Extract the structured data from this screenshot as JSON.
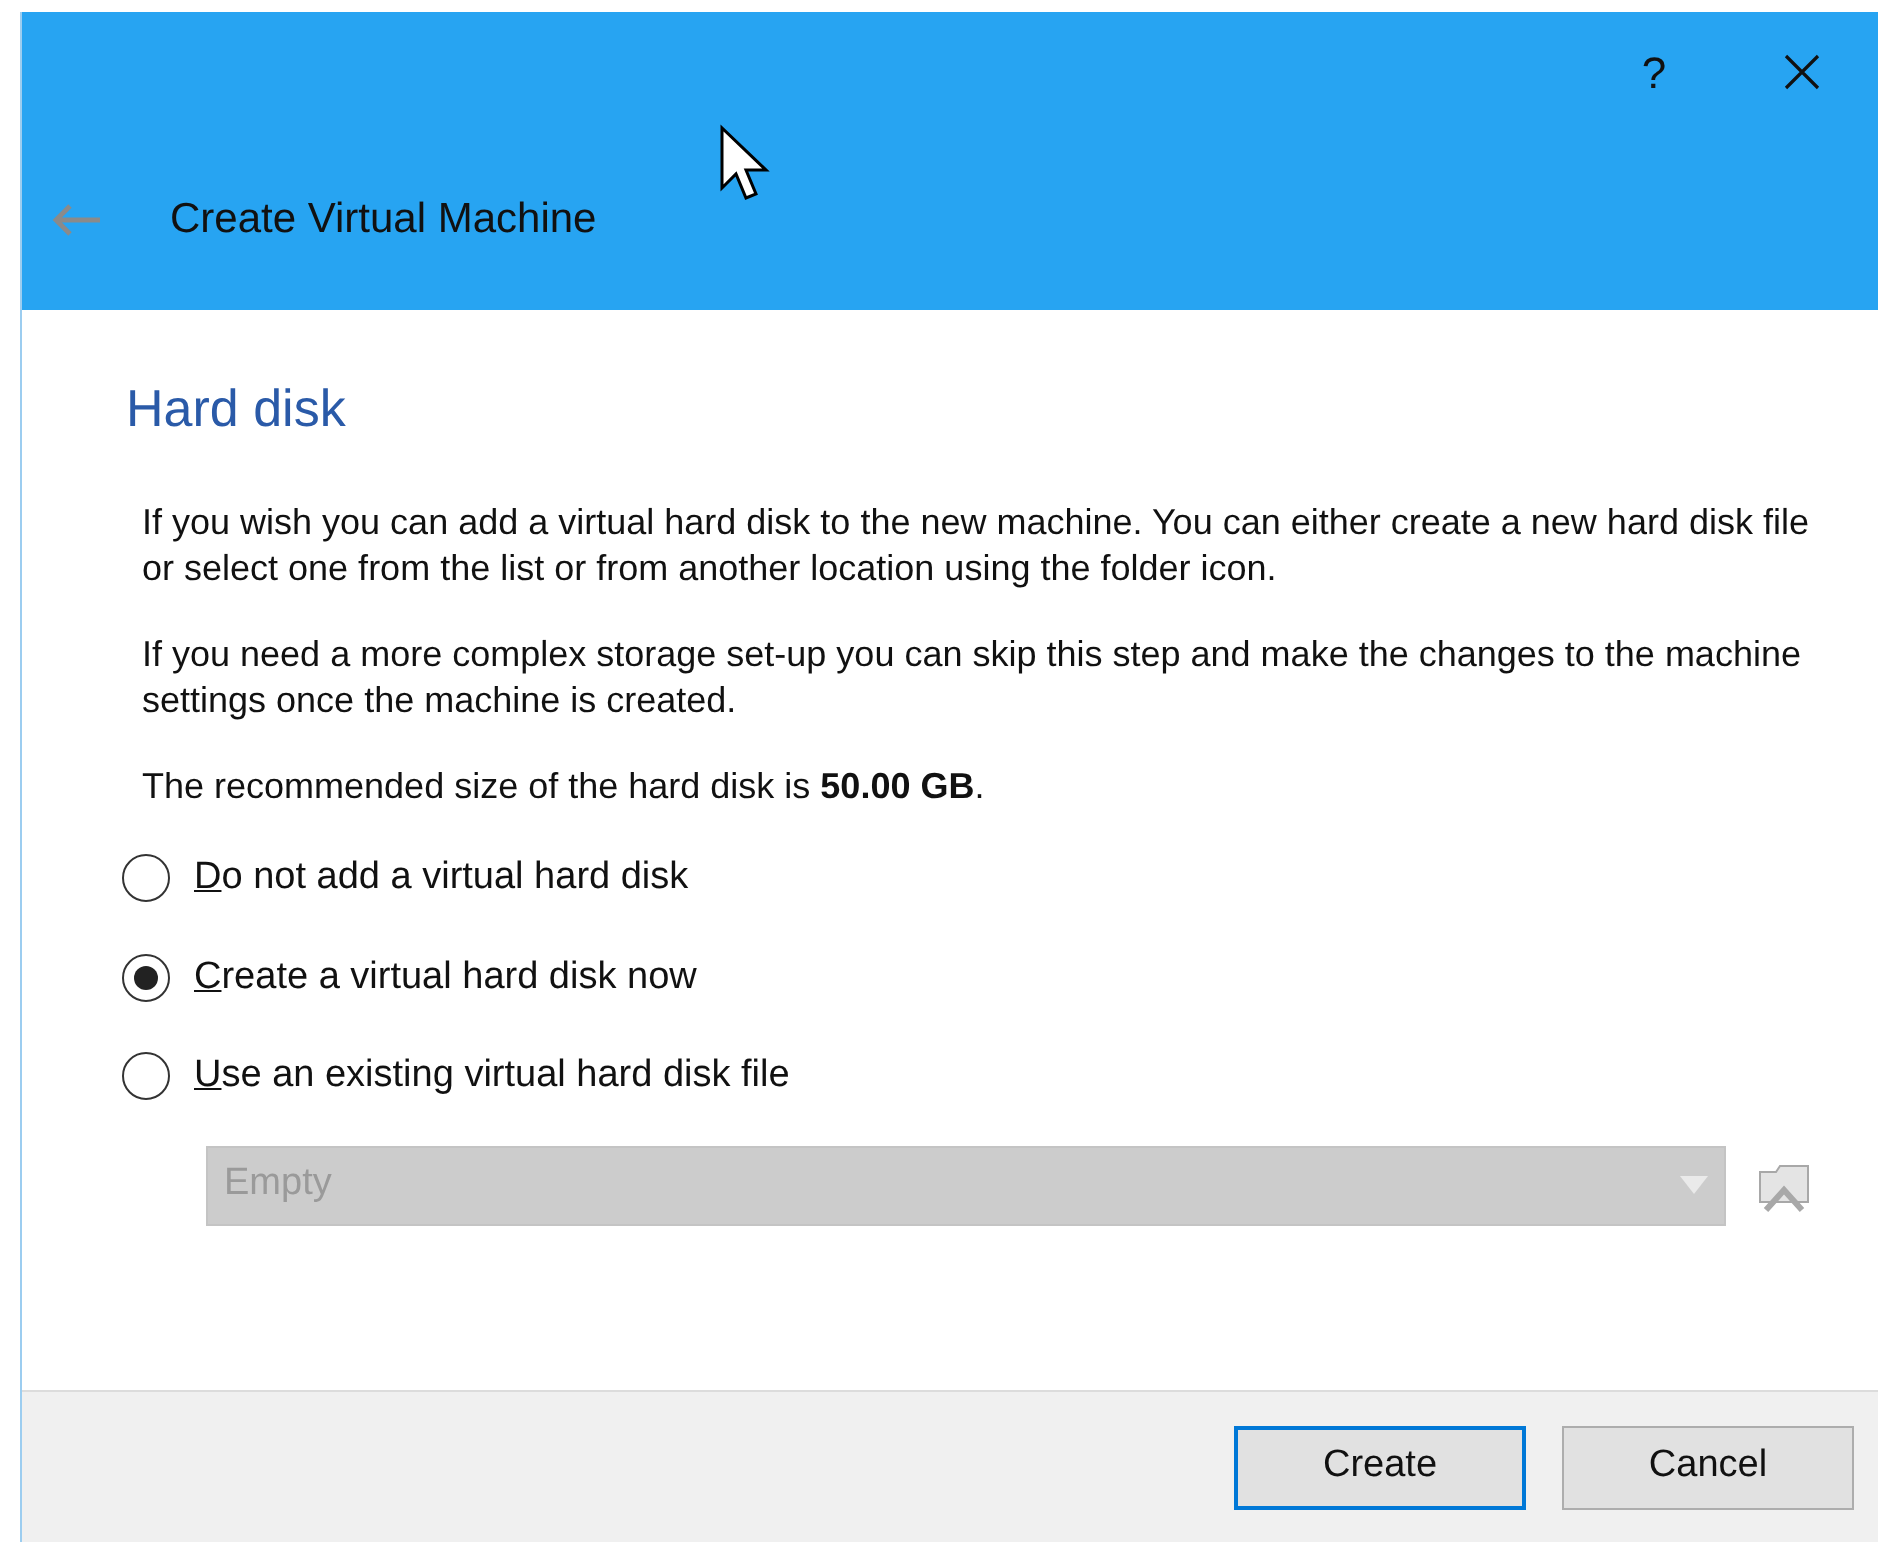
{
  "window": {
    "title": "Create Virtual Machine",
    "help": "?"
  },
  "page": {
    "heading": "Hard disk",
    "paragraphs": [
      "If you wish you can add a virtual hard disk to the new machine. You can either create a new hard disk file or select one from the list or from another location using the folder icon.",
      "If you need a more complex storage set-up you can skip this step and make the changes to the machine settings once the machine is created.",
      "The recommended size of the hard disk is **50.00 GB**."
    ],
    "options": [
      {
        "label": "Do not add a virtual hard disk",
        "selected": false
      },
      {
        "label": "Create a virtual hard disk now",
        "selected": true
      },
      {
        "label": "Use an existing virtual hard disk file",
        "selected": false
      }
    ],
    "disk_combo": {
      "value": "Empty",
      "disabled": true
    }
  },
  "buttons": [
    {
      "label": "Create",
      "default": true
    },
    {
      "label": "Cancel",
      "default": false
    }
  ]
}
